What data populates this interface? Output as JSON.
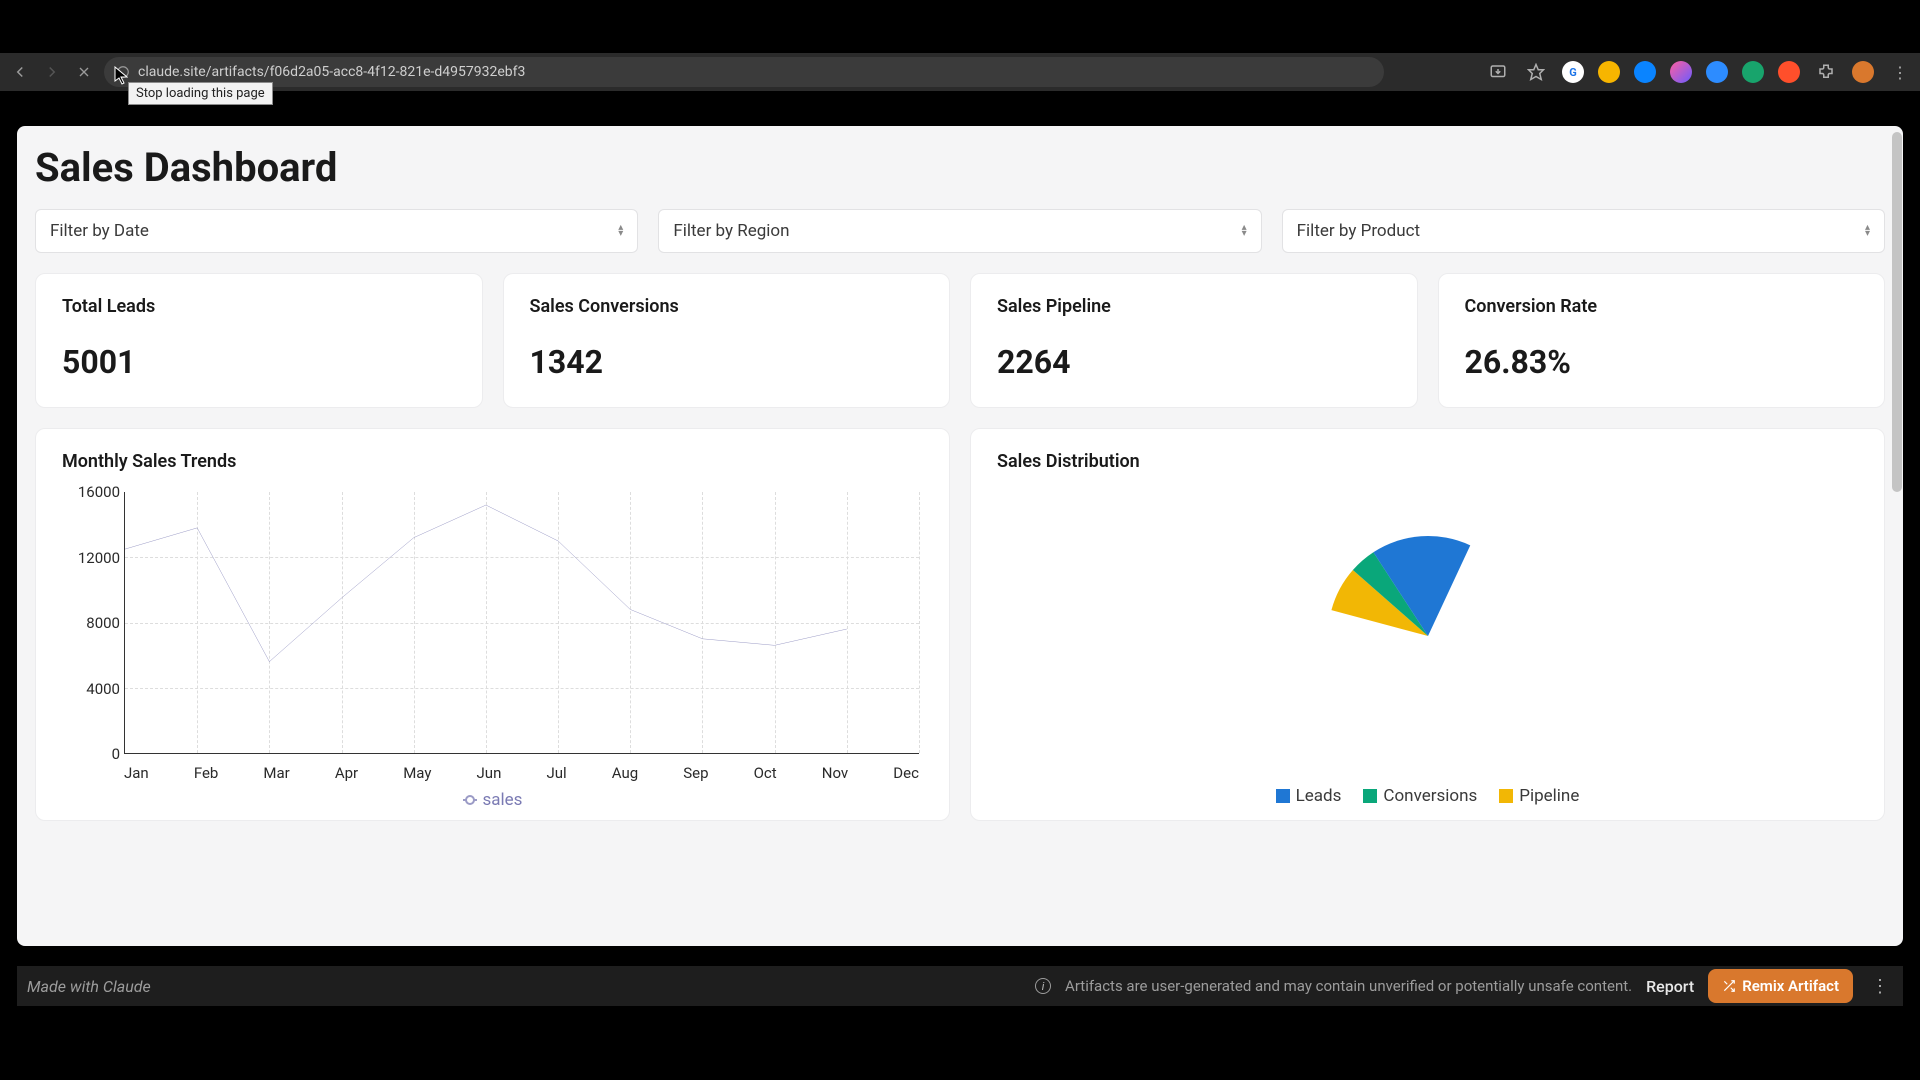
{
  "browser": {
    "url": "claude.site/artifacts/f06d2a05-acc8-4f12-821e-d4957932ebf3",
    "tooltip": "Stop loading this page"
  },
  "page_title": "Sales Dashboard",
  "filters": {
    "date": "Filter by Date",
    "region": "Filter by Region",
    "product": "Filter by Product"
  },
  "kpis": [
    {
      "title": "Total Leads",
      "value": "5001"
    },
    {
      "title": "Sales Conversions",
      "value": "1342"
    },
    {
      "title": "Sales Pipeline",
      "value": "2264"
    },
    {
      "title": "Conversion Rate",
      "value": "26.83%"
    }
  ],
  "charts": {
    "line_title": "Monthly Sales Trends",
    "pie_title": "Sales Distribution",
    "line_legend": "sales",
    "pie_legend": {
      "leads": "Leads",
      "conversions": "Conversions",
      "pipeline": "Pipeline"
    }
  },
  "colors": {
    "leads": "#1f77d4",
    "conversions": "#0aa77a",
    "pipeline": "#f2b705",
    "line": "#9b9bc6"
  },
  "bottom": {
    "made_with": "Made with Claude",
    "warning": "Artifacts are user-generated and may contain unverified or potentially unsafe content.",
    "report": "Report",
    "remix": "Remix Artifact"
  },
  "chart_data": [
    {
      "type": "line",
      "title": "Monthly Sales Trends",
      "xlabel": "",
      "ylabel": "",
      "ylim": [
        0,
        16000
      ],
      "yticks": [
        0,
        4000,
        8000,
        12000,
        16000
      ],
      "categories": [
        "Jan",
        "Feb",
        "Mar",
        "Apr",
        "May",
        "Jun",
        "Jul",
        "Aug",
        "Sep",
        "Oct",
        "Nov",
        "Dec"
      ],
      "series": [
        {
          "name": "sales",
          "values": [
            12500,
            13800,
            5600,
            9500,
            13200,
            15200,
            13000,
            8800,
            7000,
            6600,
            7600,
            null
          ]
        }
      ]
    },
    {
      "type": "pie",
      "title": "Sales Distribution",
      "series": [
        {
          "name": "Leads",
          "value": 5001
        },
        {
          "name": "Conversions",
          "value": 1342
        },
        {
          "name": "Pipeline",
          "value": 2264
        }
      ],
      "note": "rendered partially (pie animating in / wedge only)"
    }
  ]
}
